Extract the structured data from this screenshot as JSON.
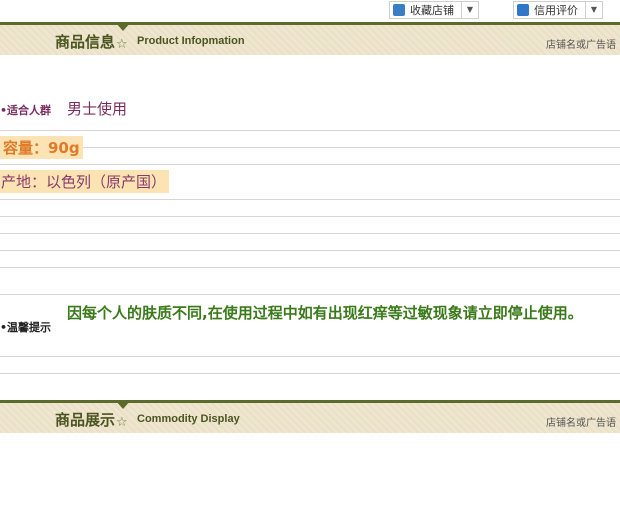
{
  "toolbar": {
    "favorite_label": "收藏店铺",
    "credit_label": "信用评价"
  },
  "product_info_header": {
    "title_cn": "商品信息",
    "title_en": "Product Infopmation",
    "slogan": "店铺名或广告语"
  },
  "info": {
    "audience_label": "•适合人群",
    "audience_value": "男士使用",
    "capacity": "容量：90g",
    "origin": "产地：以色列（原产国）",
    "tips_label": "•温馨提示",
    "tips_value": "因每个人的肤质不同,在使用过程中如有出现红痒等过敏现象请立即停止使用。"
  },
  "display_header": {
    "title_cn": "商品展示",
    "title_en": "Commodity Display",
    "slogan": "店铺名或广告语"
  }
}
